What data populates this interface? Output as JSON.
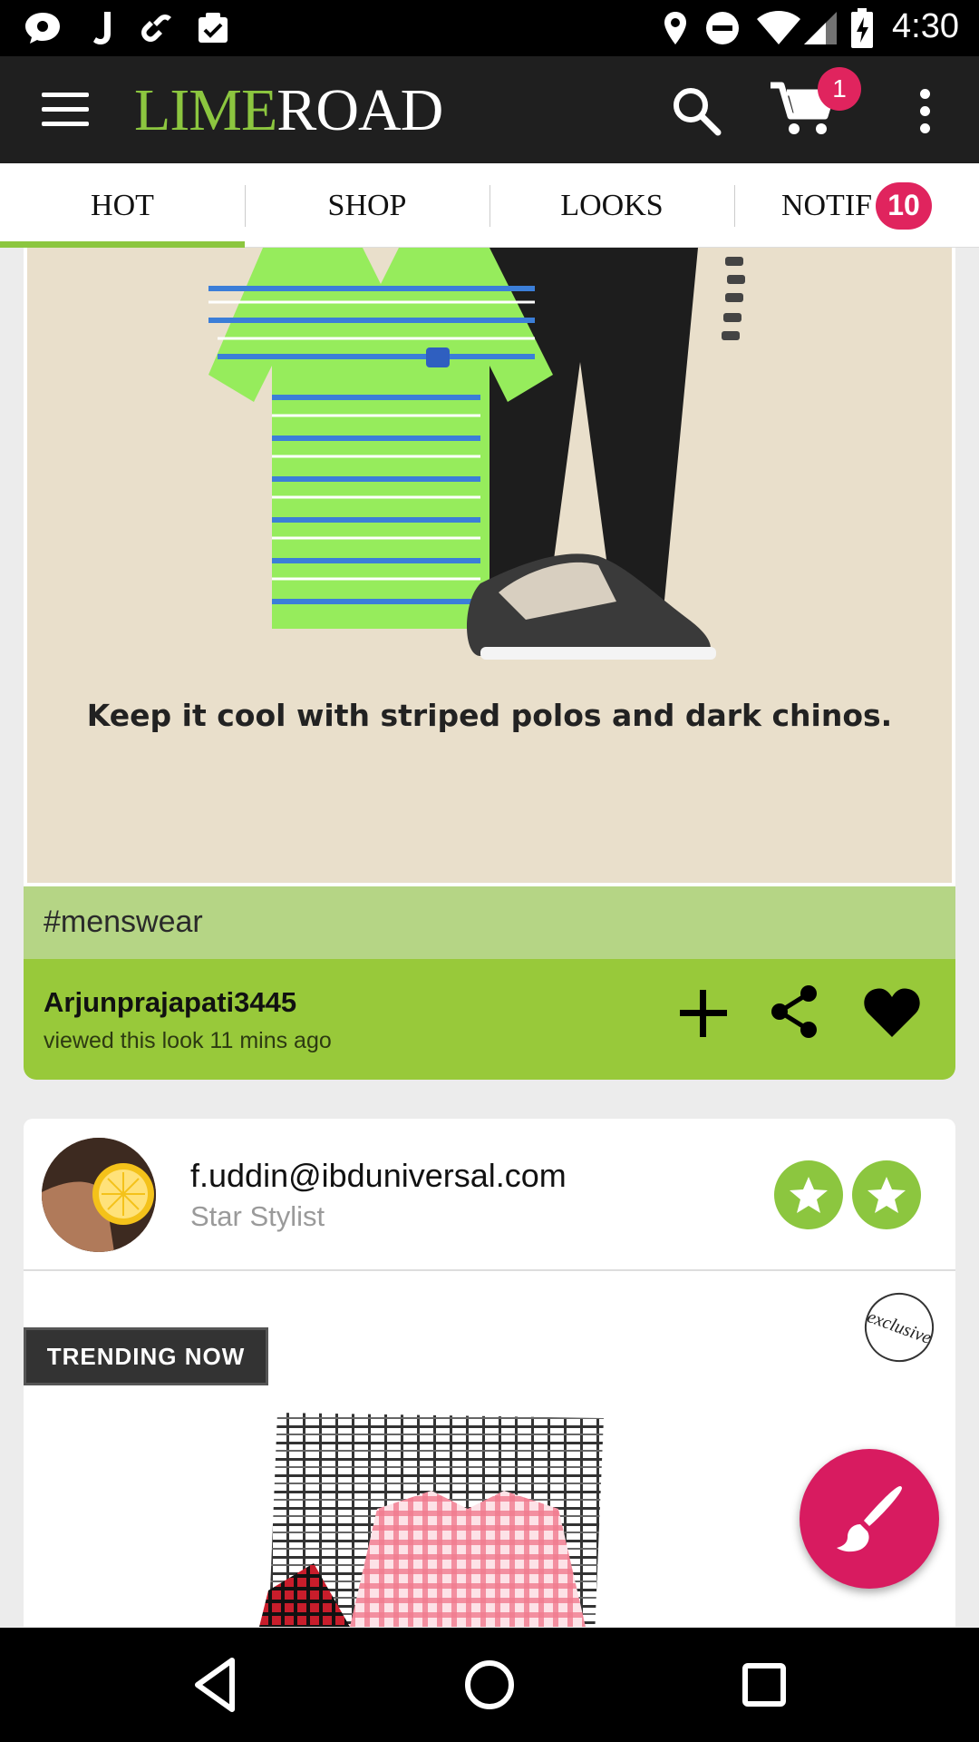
{
  "status_bar": {
    "time": "4:30",
    "icons": [
      "chat-bubble-icon",
      "j-app-icon",
      "link-icon",
      "clipboard-icon",
      "location-icon",
      "do-not-disturb-icon",
      "wifi-icon",
      "signal-icon",
      "battery-charging-icon"
    ]
  },
  "app_bar": {
    "logo_lime": "LIME",
    "logo_road": "ROAD",
    "cart_count": "1",
    "icons": [
      "menu-icon",
      "search-icon",
      "cart-icon",
      "overflow-menu-icon"
    ]
  },
  "tabs": {
    "items": [
      {
        "label": "HOT",
        "active": true
      },
      {
        "label": "SHOP",
        "active": false
      },
      {
        "label": "LOOKS",
        "active": false
      },
      {
        "label": "NOTIF",
        "active": false,
        "badge": "10"
      }
    ],
    "indicator_color": "#8cc63f"
  },
  "look_card": {
    "caption": "Keep it cool with striped polos and dark chinos.",
    "hashtag": "#menswear",
    "username": "Arjunprajapati3445",
    "activity": "viewed this look 11 mins ago",
    "actions": [
      "add-icon",
      "share-icon",
      "heart-icon"
    ]
  },
  "stylist_card": {
    "name": "f.uddin@ibduniversal.com",
    "role": "Star Stylist",
    "badges": [
      "star-badge-icon",
      "star-badge-icon"
    ],
    "trending_label": "TRENDING NOW",
    "exclusive_stamp": "exclusive"
  },
  "fab": {
    "icon": "brush-icon"
  },
  "nav_bar": {
    "icons": [
      "back-icon",
      "home-icon",
      "recents-icon"
    ]
  },
  "colors": {
    "brand_green": "#8cc63f",
    "activity_green": "#98c93a",
    "hashtag_green": "#b5d585",
    "badge_pink": "#e0245e",
    "fab_pink": "#d81b60",
    "app_bar": "#1f1f1f"
  }
}
